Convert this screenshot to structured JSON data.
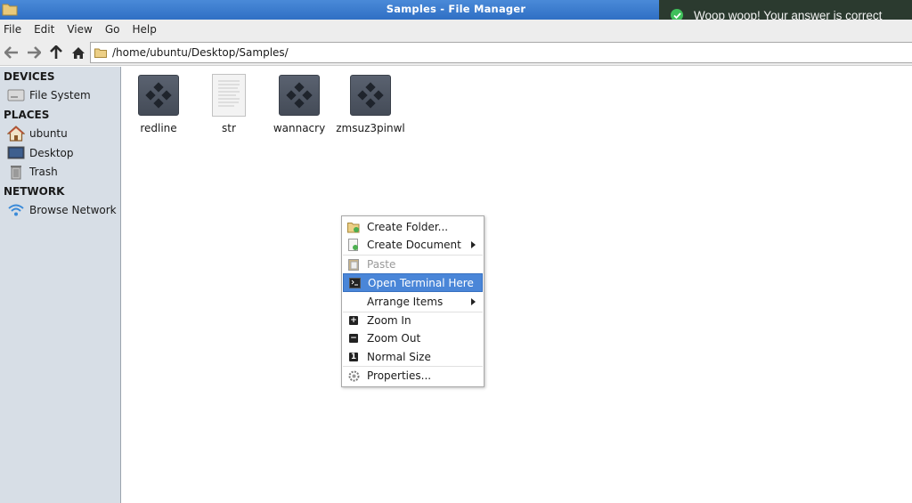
{
  "window": {
    "title": "Samples - File Manager"
  },
  "menubar": {
    "items": [
      "File",
      "Edit",
      "View",
      "Go",
      "Help"
    ]
  },
  "toolbar": {
    "path": "/home/ubuntu/Desktop/Samples/"
  },
  "sidebar": {
    "sections": [
      {
        "heading": "DEVICES",
        "items": [
          {
            "label": "File System",
            "icon": "drive-icon"
          }
        ]
      },
      {
        "heading": "PLACES",
        "items": [
          {
            "label": "ubuntu",
            "icon": "home-icon"
          },
          {
            "label": "Desktop",
            "icon": "desktop-icon"
          },
          {
            "label": "Trash",
            "icon": "trash-icon"
          }
        ]
      },
      {
        "heading": "NETWORK",
        "items": [
          {
            "label": "Browse Network",
            "icon": "wifi-icon"
          }
        ]
      }
    ]
  },
  "files": [
    {
      "name": "redline",
      "icon": "executable-icon"
    },
    {
      "name": "str",
      "icon": "text-file-icon"
    },
    {
      "name": "wannacry",
      "icon": "executable-icon"
    },
    {
      "name": "zmsuz3pinwl",
      "icon": "executable-icon"
    }
  ],
  "context_menu": {
    "items": [
      {
        "label": "Create Folder...",
        "icon": "new-folder-icon"
      },
      {
        "label": "Create Document",
        "icon": "new-document-icon",
        "submenu": true
      },
      {
        "label": "Paste",
        "icon": "paste-icon",
        "disabled": true
      },
      {
        "label": "Open Terminal Here",
        "icon": "terminal-icon",
        "highlighted": true
      },
      {
        "label": "Arrange Items",
        "submenu": true
      },
      {
        "label": "Zoom In",
        "icon": "zoom-in-icon"
      },
      {
        "label": "Zoom Out",
        "icon": "zoom-out-icon"
      },
      {
        "label": "Normal Size",
        "icon": "zoom-normal-icon"
      },
      {
        "label": "Properties...",
        "icon": "properties-icon"
      }
    ]
  },
  "toast": {
    "message": "Woop woop! Your answer is correct",
    "status": "success"
  },
  "colors": {
    "titlebar": "#2f6fc4",
    "highlight": "#4a86d8",
    "sidebar": "#d7dee6",
    "toast_bg": "#2b3a2f",
    "success": "#3fbf5a"
  }
}
